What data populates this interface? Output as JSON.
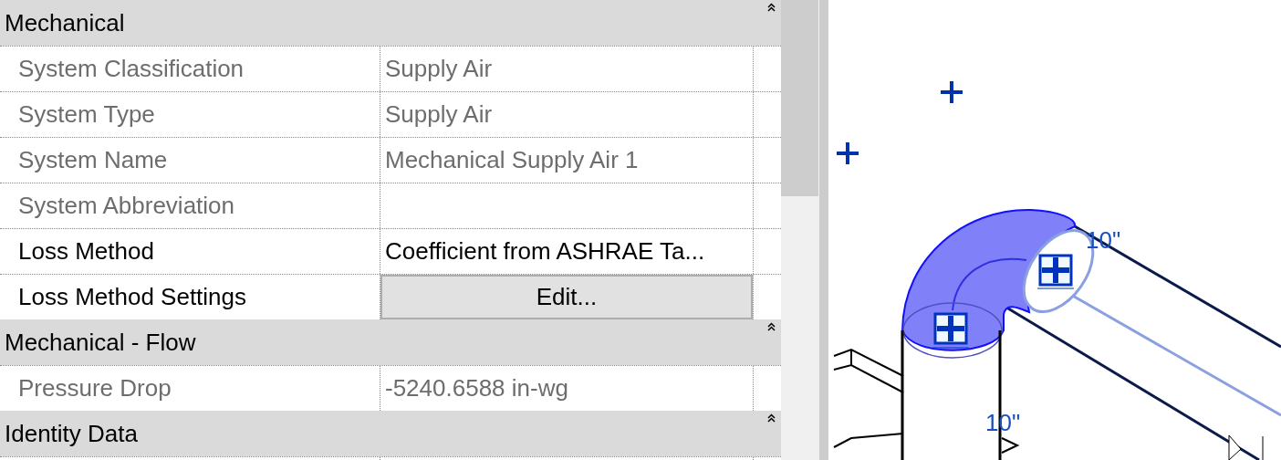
{
  "properties": {
    "groups": [
      {
        "title": "Mechanical",
        "expanded": true,
        "rows": [
          {
            "label": "System Classification",
            "value": "Supply Air",
            "disabled": true,
            "kind": "text"
          },
          {
            "label": "System Type",
            "value": "Supply Air",
            "disabled": true,
            "kind": "text"
          },
          {
            "label": "System Name",
            "value": "Mechanical Supply Air 1",
            "disabled": true,
            "kind": "text"
          },
          {
            "label": "System Abbreviation",
            "value": "",
            "disabled": true,
            "kind": "text"
          },
          {
            "label": "Loss Method",
            "value": "Coefficient from ASHRAE Ta...",
            "disabled": false,
            "kind": "text"
          },
          {
            "label": "Loss Method Settings",
            "value": "Edit...",
            "disabled": false,
            "kind": "button"
          }
        ]
      },
      {
        "title": "Mechanical - Flow",
        "expanded": true,
        "rows": [
          {
            "label": "Pressure Drop",
            "value": "-5240.6588 in-wg",
            "disabled": true,
            "kind": "text"
          }
        ]
      },
      {
        "title": "Identity Data",
        "expanded": true
      }
    ]
  },
  "canvas": {
    "dimension_labels": [
      "10\"",
      "10\""
    ]
  }
}
